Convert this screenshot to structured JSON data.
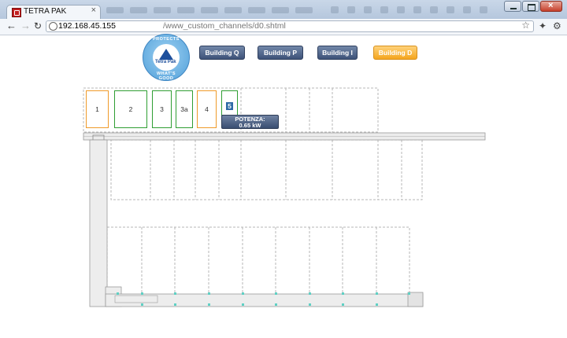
{
  "browser": {
    "tab_title": "TETRA PAK",
    "tab_close": "×",
    "url_host": "192.168.45.155",
    "url_path": "/www_custom_channels/d0.shtml"
  },
  "logo": {
    "ring_top": "PROTECTS",
    "brand": "Tetra Pak",
    "ring_bottom": "WHAT'S GOOD"
  },
  "buildings": [
    {
      "label": "Building Q",
      "active": false
    },
    {
      "label": "Building P",
      "active": false
    },
    {
      "label": "Building I",
      "active": false
    },
    {
      "label": "Building D",
      "active": true
    }
  ],
  "rooms": [
    {
      "label": "1",
      "status": "orange"
    },
    {
      "label": "2",
      "status": "green"
    },
    {
      "label": "3",
      "status": "green"
    },
    {
      "label": "3a",
      "status": "green"
    },
    {
      "label": "4",
      "status": "orange"
    },
    {
      "label": "5",
      "status": "green"
    }
  ],
  "tooltip": {
    "title": "POTENZA:",
    "value": "0.65 kW"
  },
  "colors": {
    "active_building": "#f4a51e",
    "building_button": "#4a5f84",
    "room_ok": "#2f9e33",
    "room_warning": "#ef9a2a"
  }
}
